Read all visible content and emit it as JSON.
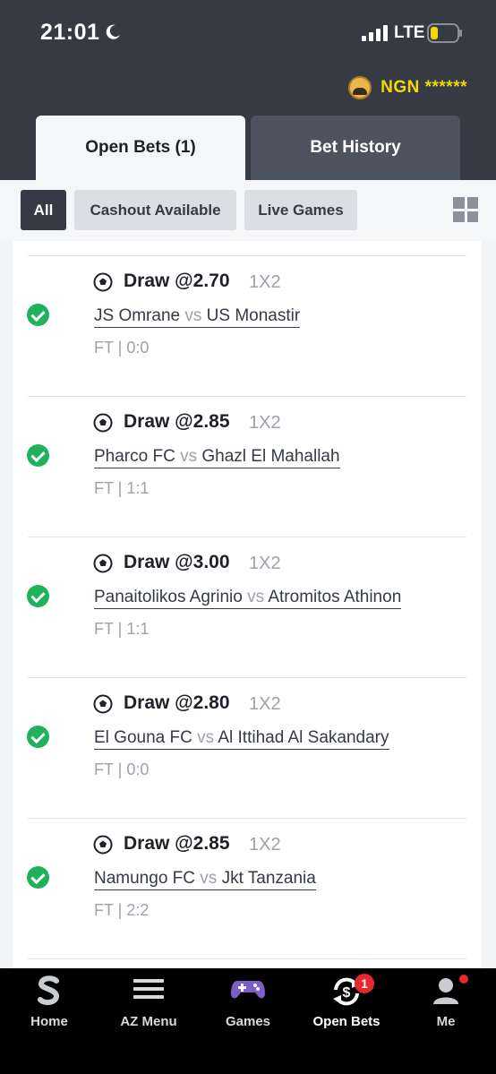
{
  "status_bar": {
    "time": "21:01",
    "network": "LTE"
  },
  "header": {
    "balance": "NGN ******",
    "tabs": [
      {
        "label": "Open Bets (1)",
        "active": true
      },
      {
        "label": "Bet History",
        "active": false
      }
    ]
  },
  "filters": {
    "chips": [
      {
        "label": "All",
        "active": true
      },
      {
        "label": "Cashout Available",
        "active": false
      },
      {
        "label": "Live Games",
        "active": false
      }
    ]
  },
  "bets": [
    {
      "selection": "Draw @2.70",
      "market": "1X2",
      "home": "JS Omrane",
      "vs": " vs ",
      "away": "US Monastir",
      "result": "FT | 0:0",
      "status": "won"
    },
    {
      "selection": "Draw @2.85",
      "market": "1X2",
      "home": "Pharco FC",
      "vs": " vs ",
      "away": "Ghazl El Mahallah",
      "result": "FT | 1:1",
      "status": "won"
    },
    {
      "selection": "Draw @3.00",
      "market": "1X2",
      "home": "Panaitolikos Agrinio",
      "vs": " vs ",
      "away": "Atromitos Athinon",
      "result": "FT | 1:1",
      "status": "won"
    },
    {
      "selection": "Draw @2.80",
      "market": "1X2",
      "home": "El Gouna FC",
      "vs": " vs ",
      "away": "Al Ittihad Al Sakandary",
      "result": "FT | 0:0",
      "status": "won"
    },
    {
      "selection": "Draw @2.85",
      "market": "1X2",
      "home": "Namungo FC",
      "vs": " vs ",
      "away": "Jkt Tanzania",
      "result": "FT | 2:2",
      "status": "won"
    }
  ],
  "bottom_nav": {
    "items": [
      {
        "label": "Home",
        "icon": "sportybet-logo-icon"
      },
      {
        "label": "AZ Menu",
        "icon": "hamburger-menu-icon"
      },
      {
        "label": "Games",
        "icon": "gamepad-icon"
      },
      {
        "label": "Open Bets",
        "icon": "open-bets-icon",
        "badge": "1",
        "active": true
      },
      {
        "label": "Me",
        "icon": "user-icon"
      }
    ]
  },
  "colors": {
    "header_bg": "#353a45",
    "balance": "#f4d800",
    "won": "#1fb25a",
    "badge": "#e8272e"
  }
}
